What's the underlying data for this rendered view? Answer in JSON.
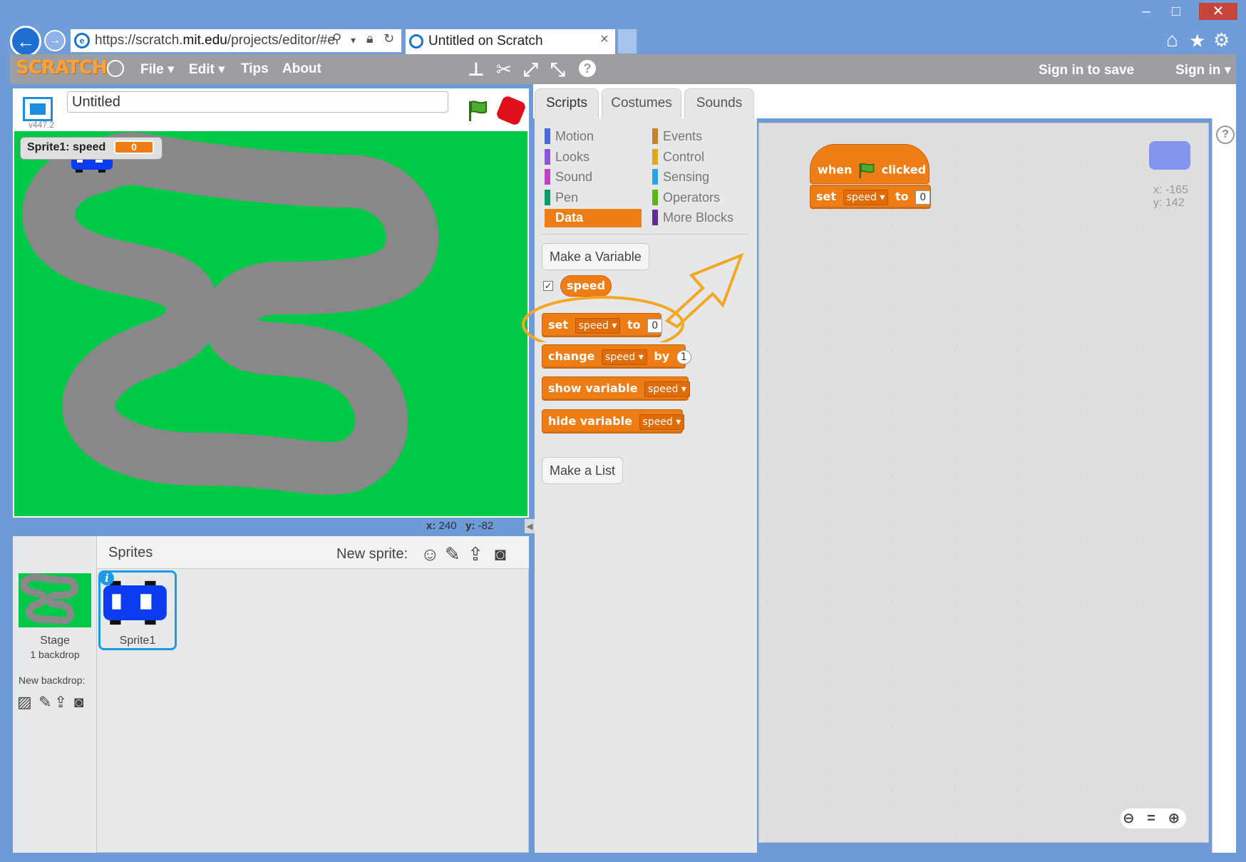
{
  "browser": {
    "url": "https://scratch.mit.edu/projects/editor/#e",
    "url_parts": {
      "pre": "https://scratch.",
      "host": "mit.edu",
      "post": "/projects/editor/#e"
    },
    "tab_title": "Untitled on Scratch",
    "tab_close": "×",
    "window_controls": {
      "minimize": "–",
      "maximize": "□",
      "close": "✕"
    },
    "nav": {
      "back": "←",
      "forward": "→"
    },
    "icons": [
      "home-icon",
      "star-icon",
      "gear-icon"
    ]
  },
  "menubar": {
    "logo": "SCRATCH",
    "items": [
      "File ▾",
      "Edit ▾",
      "Tips",
      "About"
    ],
    "sign_in_to_save": "Sign in to save",
    "sign_in": "Sign in ▾"
  },
  "stage": {
    "project_title": "Untitled",
    "version": "v447.2",
    "monitor_label": "Sprite1: speed",
    "monitor_value": "0",
    "mouse_x_label": "x:",
    "mouse_x": "240",
    "mouse_y_label": "y:",
    "mouse_y": "-82"
  },
  "sprites": {
    "title": "Sprites",
    "new_sprite_label": "New sprite:",
    "stage_name": "Stage",
    "stage_backdrops": "1 backdrop",
    "new_backdrop_label": "New backdrop:",
    "sprite_name": "Sprite1",
    "info_glyph": "i"
  },
  "editor_tabs": [
    "Scripts",
    "Costumes",
    "Sounds"
  ],
  "categories": {
    "left": [
      {
        "label": "Motion",
        "color": "#4a6cd4"
      },
      {
        "label": "Looks",
        "color": "#8a55d7"
      },
      {
        "label": "Sound",
        "color": "#bb42c3"
      },
      {
        "label": "Pen",
        "color": "#0e9a6c"
      },
      {
        "label": "Data",
        "color": "#ee7d16"
      }
    ],
    "right": [
      {
        "label": "Events",
        "color": "#c88330"
      },
      {
        "label": "Control",
        "color": "#e1a91a"
      },
      {
        "label": "Sensing",
        "color": "#2ca5e2"
      },
      {
        "label": "Operators",
        "color": "#5cb712"
      },
      {
        "label": "More Blocks",
        "color": "#632d99"
      }
    ]
  },
  "palette": {
    "make_variable": "Make a Variable",
    "variable": "speed",
    "variable_checked": "✓",
    "set_block": {
      "kw1": "set",
      "var": "speed",
      "kw2": "to",
      "value": "0"
    },
    "change_block": {
      "kw1": "change",
      "var": "speed",
      "kw2": "by",
      "value": "1"
    },
    "show_block": {
      "kw1": "show variable",
      "var": "speed"
    },
    "hide_block": {
      "kw1": "hide variable",
      "var": "speed"
    },
    "make_list": "Make a List"
  },
  "script": {
    "hat_when": "when",
    "hat_clicked": "clicked",
    "set_kw1": "set",
    "set_var": "speed",
    "set_kw2": "to",
    "set_value": "0"
  },
  "sprite_position": {
    "x": "x: -165",
    "y": "y: 142"
  },
  "zoom_controls": "⊖ = ⊕",
  "help_glyph": "?",
  "colors": {
    "data_orange": "#ee7d16",
    "stage_green": "#00c947",
    "track_gray": "#888888",
    "sprite_blue": "#0b3cf0",
    "annotation": "#f5a623"
  }
}
